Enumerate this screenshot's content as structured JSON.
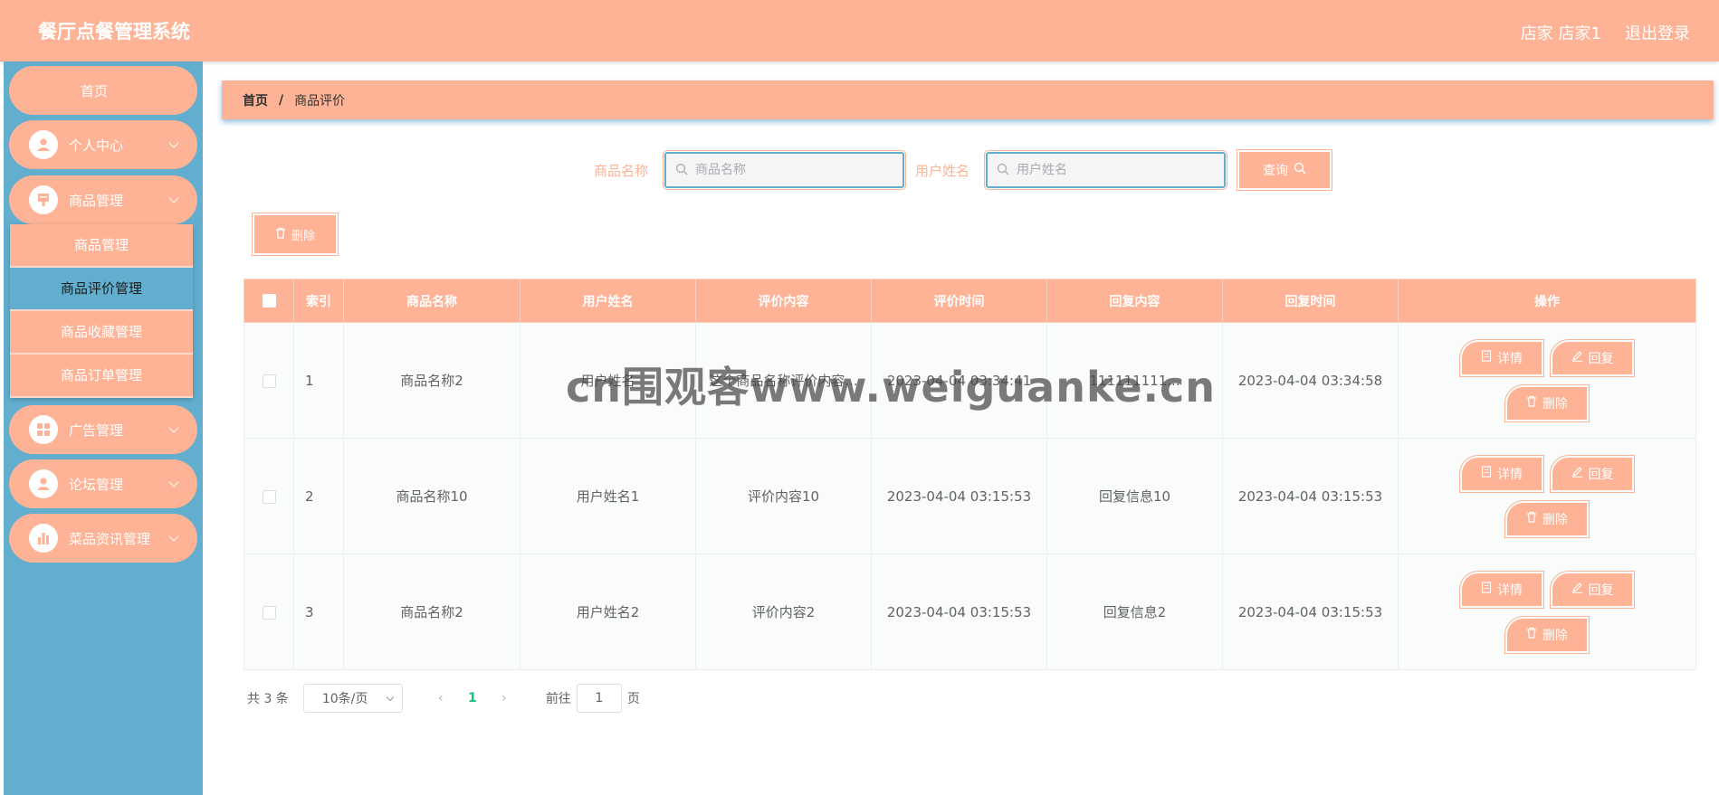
{
  "app": {
    "title": "餐厅点餐管理系统"
  },
  "header": {
    "user": "店家 店家1",
    "logout": "退出登录"
  },
  "sidebar": {
    "home": "首页",
    "items": [
      {
        "label": "个人中心",
        "icon": "user-icon"
      },
      {
        "label": "商品管理",
        "icon": "goods-icon"
      },
      {
        "label": "广告管理",
        "icon": "grid-icon"
      },
      {
        "label": "论坛管理",
        "icon": "user-icon"
      },
      {
        "label": "菜品资讯管理",
        "icon": "chart-icon"
      }
    ],
    "submenu": [
      {
        "label": "商品管理"
      },
      {
        "label": "商品评价管理"
      },
      {
        "label": "商品收藏管理"
      },
      {
        "label": "商品订单管理"
      }
    ]
  },
  "breadcrumb": {
    "home": "首页",
    "separator": "/",
    "current": "商品评价"
  },
  "search": {
    "goods_label": "商品名称",
    "goods_placeholder": "商品名称",
    "user_label": "用户姓名",
    "user_placeholder": "用户姓名",
    "query_button": "查询"
  },
  "toolbar": {
    "delete_label": "删除"
  },
  "table": {
    "columns": [
      "索引",
      "商品名称",
      "用户姓名",
      "评价内容",
      "评价时间",
      "回复内容",
      "回复时间",
      "操作"
    ],
    "rows": [
      {
        "index": "1",
        "goods": "商品名称2",
        "user": "用户姓名",
        "content": "这个商品名称评价内容...",
        "time": "2023-04-04 03:34:41",
        "reply": "111111111...",
        "reply_time": "2023-04-04 03:34:58"
      },
      {
        "index": "2",
        "goods": "商品名称10",
        "user": "用户姓名1",
        "content": "评价内容10",
        "time": "2023-04-04 03:15:53",
        "reply": "回复信息10",
        "reply_time": "2023-04-04 03:15:53"
      },
      {
        "index": "3",
        "goods": "商品名称2",
        "user": "用户姓名2",
        "content": "评价内容2",
        "time": "2023-04-04 03:15:53",
        "reply": "回复信息2",
        "reply_time": "2023-04-04 03:15:53"
      }
    ],
    "actions": {
      "detail": "详情",
      "reply": "回复",
      "delete": "删除"
    }
  },
  "pagination": {
    "total": "共 3 条",
    "page_size": "10条/页",
    "prev": "‹",
    "current_page": "1",
    "next": "›",
    "goto_prefix": "前往",
    "goto_value": "1",
    "goto_suffix": "页"
  },
  "watermark": "cn围观客www.weiguanke.cn",
  "colors": {
    "primary": "#feb396",
    "sidebar": "#62aecf",
    "active_page": "#13c27a"
  }
}
